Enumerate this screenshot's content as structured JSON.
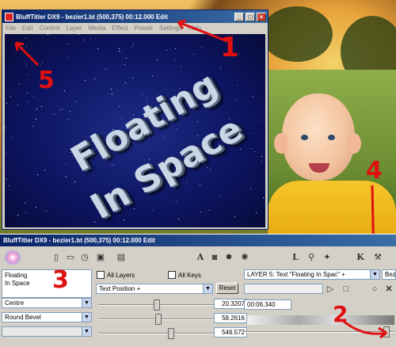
{
  "window": {
    "title": "BluffTitler DX9 - bezier1.bt (500,375) 00:12.000 Edit",
    "controls": [
      "_",
      "□",
      "×"
    ]
  },
  "menu": [
    "File",
    "Edit",
    "Control",
    "Layer",
    "Media",
    "Effect",
    "Preset",
    "Settings",
    "Help"
  ],
  "scene_text": [
    "Floating",
    "In Space"
  ],
  "annotations": [
    "1",
    "2",
    "3",
    "4",
    "5"
  ],
  "panel": {
    "title": "BluffTitler DX9 - bezier1.bt (500,375) 00:12.000 Edit",
    "text_box": [
      "Floating",
      "In Space"
    ],
    "all_layers": "All Layers",
    "all_keys": "All Keys",
    "property": "Text Position +",
    "reset": "Reset",
    "alignment": "Centre",
    "bevel": "Round Bevel",
    "values": [
      "20.3207",
      "58.2616",
      "546.572"
    ],
    "layer_select": "LAYER 5: Text \"Floating In Spac\" +",
    "layer_select_2": "Bezi",
    "time": "00:06.340"
  },
  "toolbar_icons": [
    "new-icon",
    "open-icon",
    "clock-icon",
    "save-icon",
    "save-as-icon",
    "text-icon",
    "camera-icon",
    "light-icon",
    "particles-icon",
    "layer-icon",
    "tree-icon",
    "plugin-icon",
    "tools-icon"
  ]
}
